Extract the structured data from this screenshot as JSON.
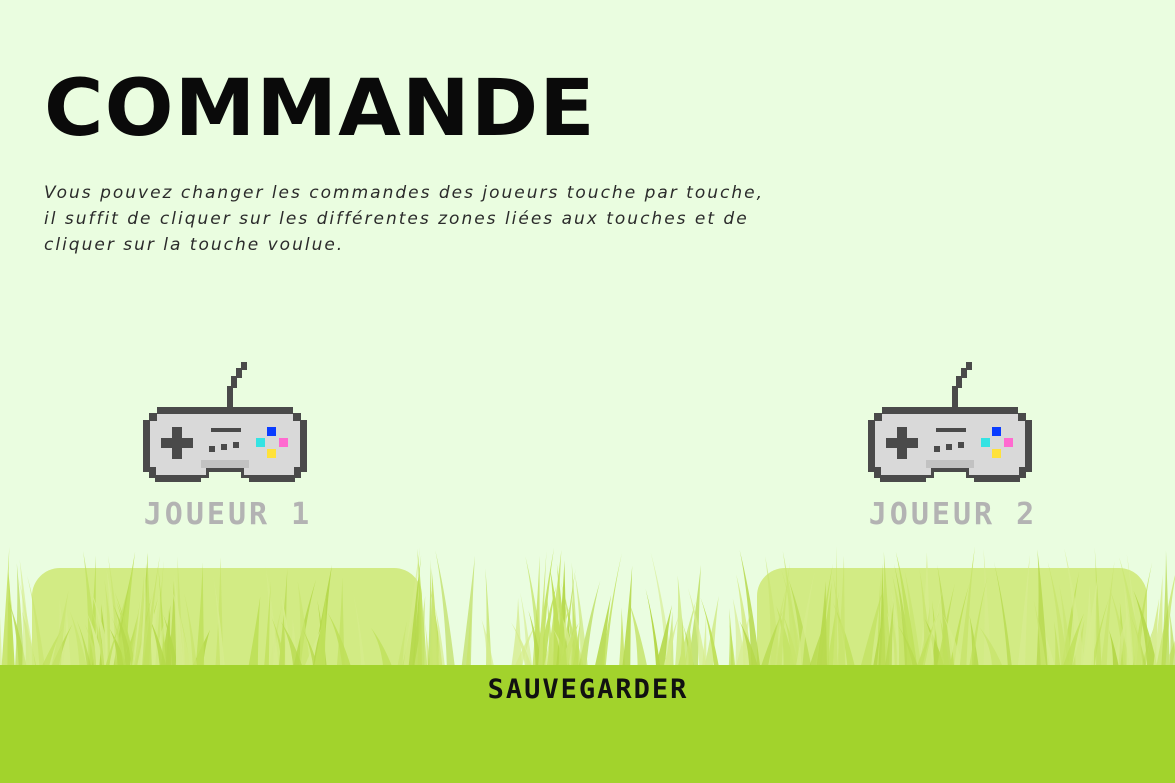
{
  "header": {
    "title": "COMMANDE",
    "description": "Vous pouvez changer les commandes des joueurs touche par touche, il suffit de cliquer sur les différentes zones liées aux touches et de cliquer sur la touche voulue."
  },
  "players": [
    {
      "label": "JOUEUR 1",
      "icon": "gamepad-icon"
    },
    {
      "label": "JOUEUR 2",
      "icon": "gamepad-icon"
    }
  ],
  "footer": {
    "save_label": "SAUVEGARDER"
  },
  "colors": {
    "background": "#eafde0",
    "ground": "#a2d32c",
    "grass": "#c9e56f",
    "pad": "#d2eb84",
    "label": "#b3b3b3",
    "controller_body": "#d9d9d9",
    "controller_outline": "#4a4a4a",
    "button_blue": "#0a3cff",
    "button_cyan": "#35e3e3",
    "button_pink": "#ff6ad0",
    "button_yellow": "#ffe23a"
  }
}
